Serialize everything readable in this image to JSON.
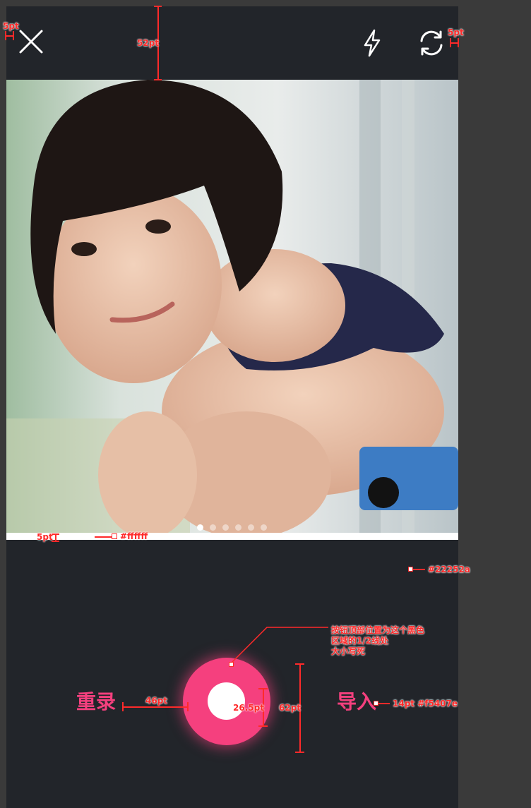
{
  "screen": {
    "background": "#22252a"
  },
  "topbar": {
    "close_icon": "close-icon",
    "flash_icon": "flash-icon",
    "switch_camera_icon": "switch-camera-icon"
  },
  "photo": {
    "description_icon": "photo-preview",
    "pages": 6,
    "active_page": 1
  },
  "controls": {
    "retake_label": "重录",
    "import_label": "导入",
    "record_color": "#f5407e"
  },
  "annotations": {
    "top_left_margin": "5pt",
    "top_right_margin": "5pt",
    "topbar_height": "52pt",
    "strip_height": "5pt",
    "strip_color": "#ffffff",
    "bg_color": "#22252a",
    "note_line1": "按钮顶部位置为这个黑色",
    "note_line2": "区域的1/2线处",
    "note_line3": "大小写死",
    "spacing": "46pt",
    "inner_size": "26.5pt",
    "outer_size": "62pt",
    "label_spec": "14pt #f5407e"
  }
}
